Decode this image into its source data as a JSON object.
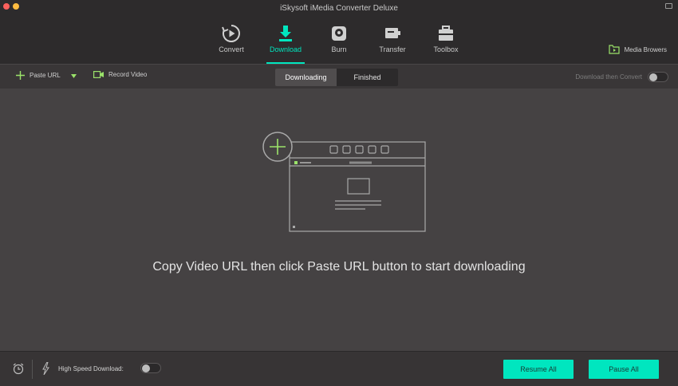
{
  "window": {
    "title": "iSkysoft iMedia Converter Deluxe"
  },
  "nav": {
    "items": [
      {
        "label": "Convert",
        "icon": "convert-icon"
      },
      {
        "label": "Download",
        "icon": "download-icon"
      },
      {
        "label": "Burn",
        "icon": "disc-icon"
      },
      {
        "label": "Transfer",
        "icon": "transfer-icon"
      },
      {
        "label": "Toolbox",
        "icon": "toolbox-icon"
      }
    ],
    "active": "Download",
    "media_browsers": "Media Browers"
  },
  "toolbar": {
    "paste_url": "Paste URL",
    "record_video": "Record Video",
    "tabs": [
      "Downloading",
      "Finished"
    ],
    "active_tab": "Downloading",
    "download_then_convert": "Download then Convert",
    "download_then_convert_on": false
  },
  "main": {
    "empty_message": "Copy Video URL then click Paste URL button to start downloading"
  },
  "bottom": {
    "high_speed_label": "High Speed Download:",
    "high_speed_on": false,
    "resume_all": "Resume All",
    "pause_all": "Pause All"
  },
  "colors": {
    "accent": "#00e6bf",
    "background": "#454243",
    "topbar": "#2d2b2c"
  }
}
